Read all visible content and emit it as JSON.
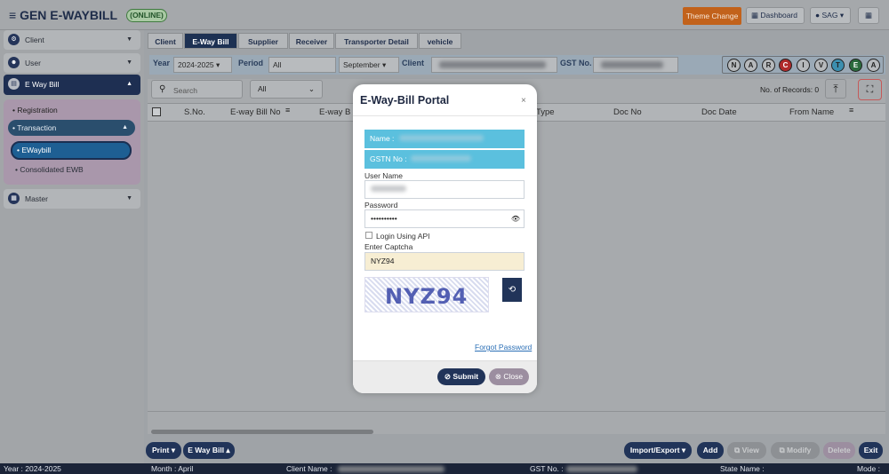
{
  "header": {
    "title": "GEN E-WAYBILL",
    "status": "(ONLINE)",
    "theme_button": "Theme Change",
    "dashboard": "Dashboard",
    "user": "SAG"
  },
  "sidebar": {
    "items": [
      {
        "label": "Client"
      },
      {
        "label": "User"
      },
      {
        "label": "E Way Bill"
      },
      {
        "label": "Registration"
      },
      {
        "label": "Transaction"
      },
      {
        "label": "EWaybill"
      },
      {
        "label": "Consolidated EWB"
      },
      {
        "label": "Master"
      }
    ]
  },
  "tabs": [
    "Client",
    "E-Way Bill",
    "Supplier",
    "Receiver",
    "Transporter Detail",
    "vehicle"
  ],
  "filters": {
    "year_label": "Year",
    "year_value": "2024-2025",
    "period_label": "Period",
    "period_value": "All",
    "month_value": "September",
    "client_label": "Client",
    "gst_label": "GST No."
  },
  "status_letters": [
    "N",
    "A",
    "R",
    "C",
    "I",
    "V",
    "T",
    "E",
    "A"
  ],
  "toolbar": {
    "search_placeholder": "Search",
    "filter_value": "All",
    "records": "No. of Records: 0"
  },
  "columns": [
    "S.No.",
    "E-way Bill No",
    "E-way B",
    "Type",
    "Doc No",
    "Doc Date",
    "From Name"
  ],
  "buttons": {
    "print": "Print",
    "ewaybill": "E Way Bill",
    "import_export": "Import/Export",
    "add": "Add",
    "view": "View",
    "modify": "Modify",
    "delete": "Delete",
    "exit": "Exit"
  },
  "statusbar": {
    "year": "Year : 2024-2025",
    "month": "Month : April",
    "client": "Client Name :",
    "gst": "GST No. :",
    "state": "State Name :",
    "mode": "Mode :"
  },
  "modal": {
    "title": "E-Way-Bill Portal",
    "name_label": "Name :",
    "gstn_label": "GSTN No :",
    "username_label": "User Name",
    "password_label": "Password",
    "password_value": "••••••••••",
    "api_label": "Login Using API",
    "captcha_label": "Enter Captcha",
    "captcha_value": "NYZ94",
    "captcha_image_text": "NYZ94",
    "forgot": "Forgot Password",
    "submit": "Submit",
    "close": "Close"
  }
}
